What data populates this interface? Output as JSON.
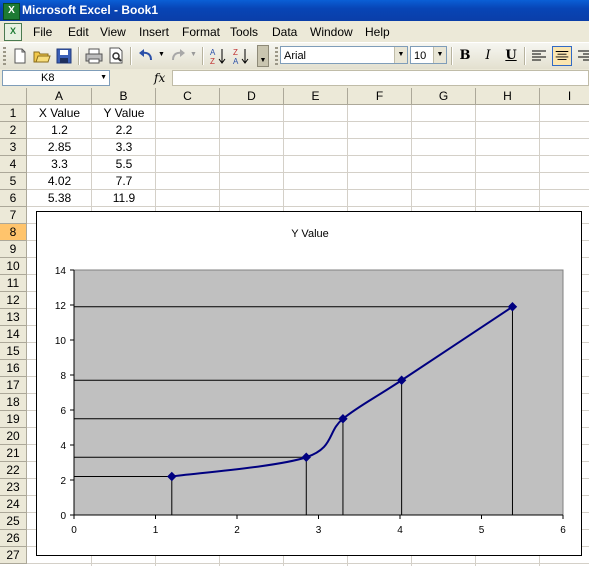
{
  "window": {
    "title": "Microsoft Excel - Book1"
  },
  "menu": [
    "File",
    "Edit",
    "View",
    "Insert",
    "Format",
    "Tools",
    "Data",
    "Window",
    "Help"
  ],
  "toolbar": {
    "font_name": "Arial",
    "font_size": "10",
    "bold_label": "B",
    "italic_label": "I",
    "underline_label": "U"
  },
  "formula_bar": {
    "name_box": "K8",
    "fx_label": "fx",
    "formula": ""
  },
  "columns": [
    "A",
    "B",
    "C",
    "D",
    "E",
    "F",
    "G",
    "H",
    "I"
  ],
  "rows": [
    "1",
    "2",
    "3",
    "4",
    "5",
    "6",
    "7",
    "8",
    "9",
    "10",
    "11",
    "12",
    "13",
    "14",
    "15",
    "16",
    "17",
    "18",
    "19",
    "20",
    "21",
    "22",
    "23",
    "24",
    "25",
    "26",
    "27"
  ],
  "sheet": {
    "header": [
      "X Value",
      "Y Value"
    ],
    "data": [
      [
        "1.2",
        "2.2"
      ],
      [
        "2.85",
        "3.3"
      ],
      [
        "3.3",
        "5.5"
      ],
      [
        "4.02",
        "7.7"
      ],
      [
        "5.38",
        "11.9"
      ]
    ]
  },
  "chart_data": {
    "type": "scatter",
    "title": "Y Value",
    "series": [
      {
        "name": "Y Value",
        "x": [
          1.2,
          2.85,
          3.3,
          4.02,
          5.38
        ],
        "y": [
          2.2,
          3.3,
          5.5,
          7.7,
          11.9
        ]
      }
    ],
    "xlim": [
      0,
      6
    ],
    "ylim": [
      0,
      14
    ],
    "x_ticks": [
      "0",
      "1",
      "2",
      "3",
      "4",
      "5",
      "6"
    ],
    "y_ticks": [
      "0",
      "2",
      "4",
      "6",
      "8",
      "10",
      "12",
      "14"
    ],
    "smoothed": true,
    "drop_lines": true,
    "plot_area_color": "#c0c0c0",
    "series_color": "#000080"
  }
}
